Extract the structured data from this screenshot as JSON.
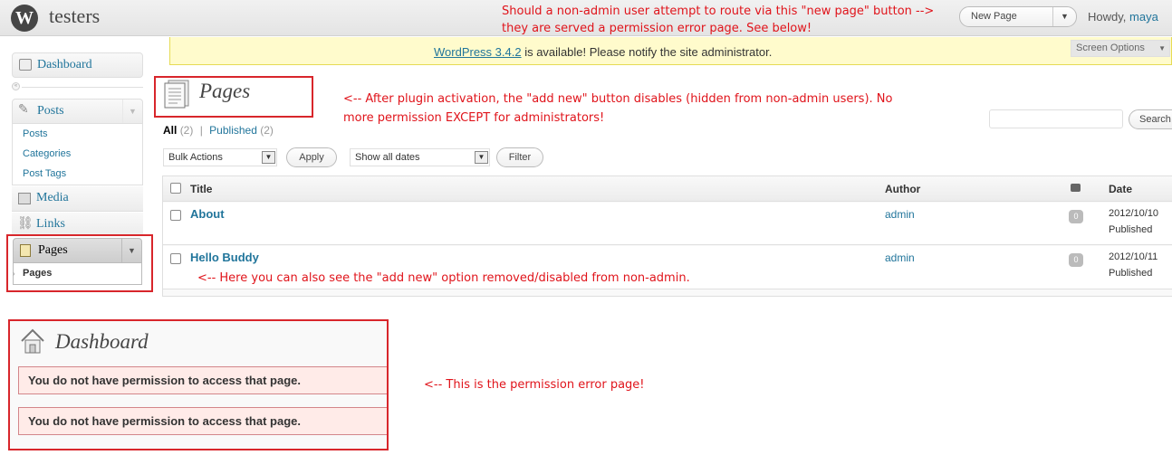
{
  "header": {
    "site_name": "testers",
    "new_page_label": "New Page",
    "howdy_prefix": "Howdy,",
    "username": "maya"
  },
  "notice": {
    "link_text": "WordPress 3.4.2",
    "message": " is available! Please notify the site administrator.",
    "screen_options": "Screen Options"
  },
  "sidebar": {
    "dashboard": "Dashboard",
    "posts": "Posts",
    "posts_sub": [
      "Posts",
      "Categories",
      "Post Tags"
    ],
    "media": "Media",
    "links": "Links",
    "pages": "Pages",
    "pages_sub": "Pages"
  },
  "main": {
    "title": "Pages",
    "filter_all": "All",
    "filter_all_count": "(2)",
    "filter_sep": "|",
    "filter_published": "Published",
    "filter_published_count": "(2)",
    "bulk_actions": "Bulk Actions",
    "apply": "Apply",
    "show_dates": "Show all dates",
    "filter": "Filter",
    "search_button": "Search",
    "columns": {
      "title": "Title",
      "author": "Author",
      "date": "Date"
    },
    "rows": [
      {
        "title": "About",
        "author": "admin",
        "comments": "0",
        "date": "2012/10/10",
        "status": "Published"
      },
      {
        "title": "Hello Buddy",
        "author": "admin",
        "comments": "0",
        "date": "2012/10/11",
        "status": "Published"
      }
    ]
  },
  "error_panel": {
    "title": "Dashboard",
    "messages": [
      "You do not have permission to access that page.",
      "You do not have permission to access that page."
    ]
  },
  "annotations": {
    "top_line1": "Should a non-admin user attempt to route via this \"new page\" button -->",
    "top_line2": "they are served a permission error page. See below!",
    "pages_line1": "<-- After plugin activation, the \"add new\" button disables (hidden from non-admin users). No",
    "pages_line2": "more permission EXCEPT for administrators!",
    "row_note": "<-- Here you can also see the \"add new\" option removed/disabled from non-admin.",
    "error_note": "<-- This is the permission error page!"
  },
  "colors": {
    "accent": "#21759b",
    "annotation": "#e0141b",
    "error_bg": "#ffebe8",
    "notice_bg": "#fffbcc"
  }
}
